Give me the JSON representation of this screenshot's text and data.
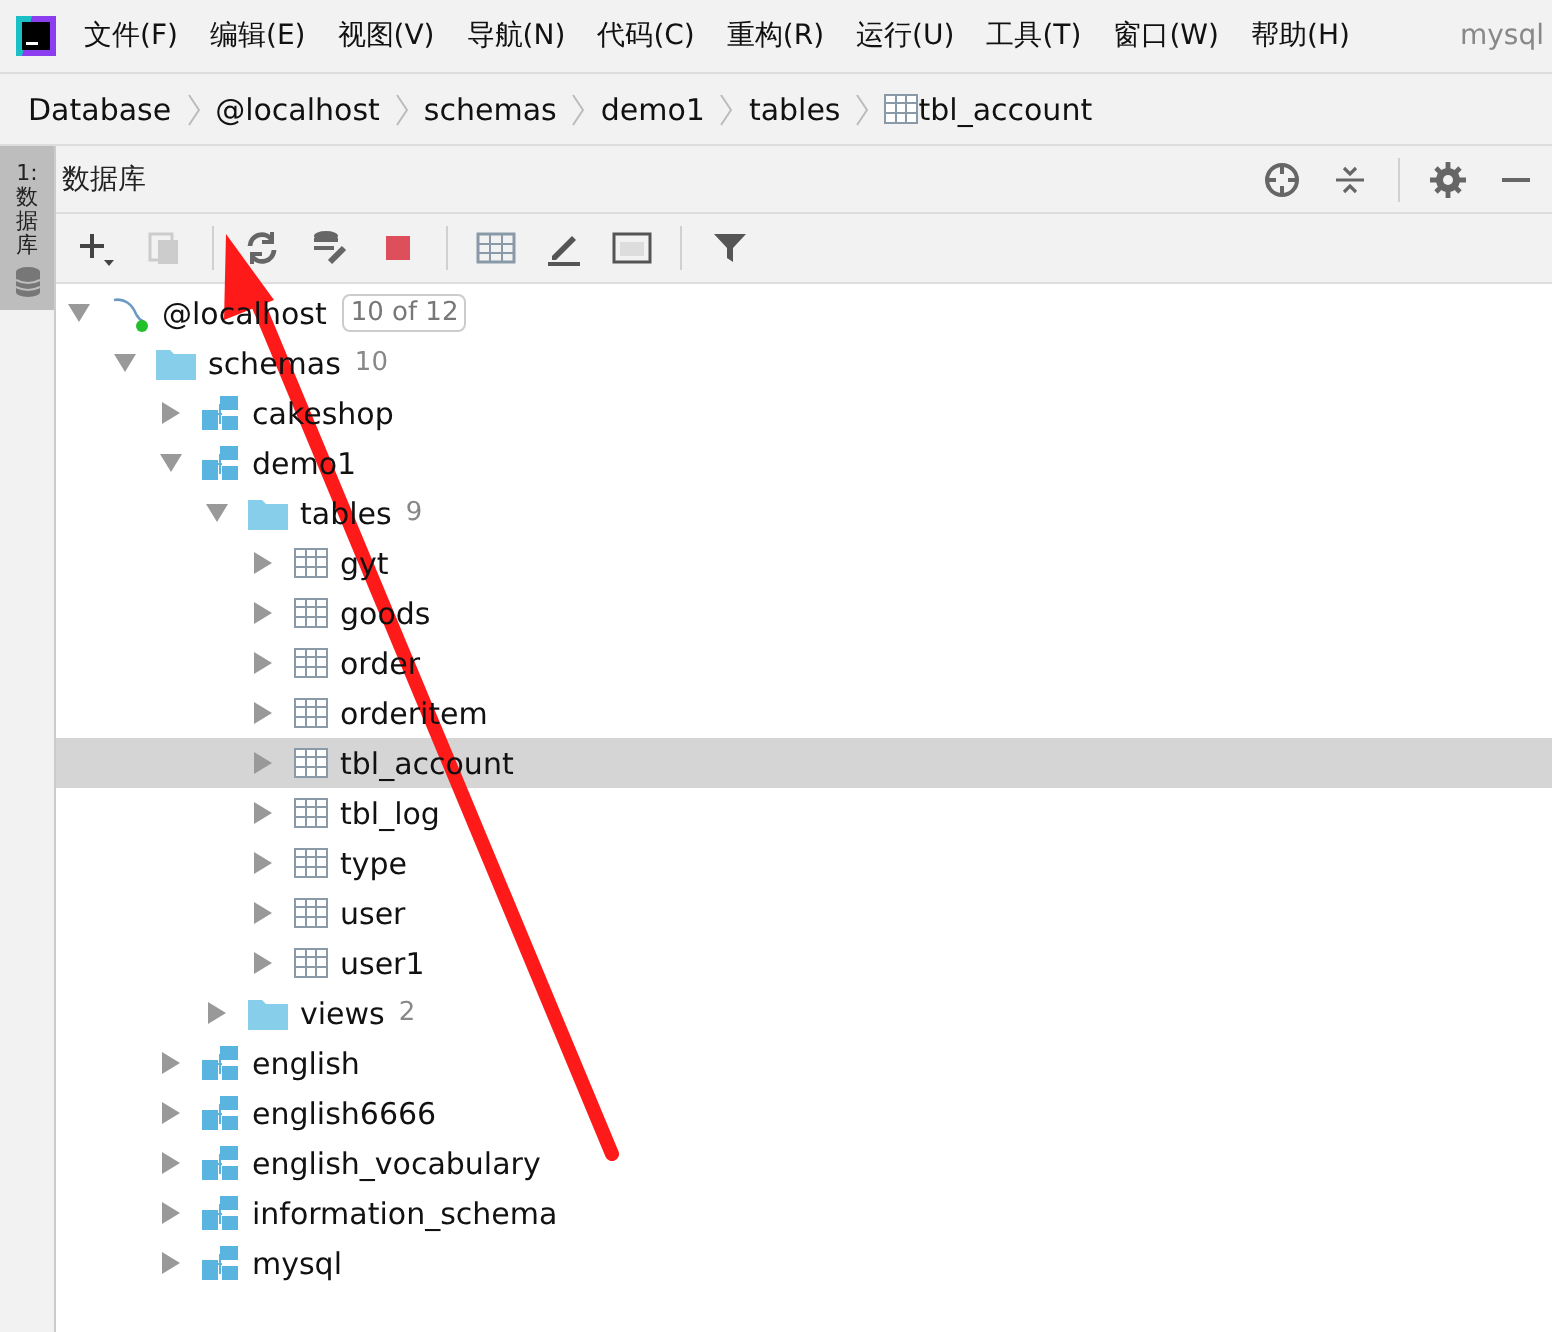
{
  "menu": [
    "文件(F)",
    "编辑(E)",
    "视图(V)",
    "导航(N)",
    "代码(C)",
    "重构(R)",
    "运行(U)",
    "工具(T)",
    "窗口(W)",
    "帮助(H)"
  ],
  "project": "mysql",
  "breadcrumb": [
    {
      "label": "Database",
      "kind": "plain"
    },
    {
      "label": "@localhost",
      "kind": "plain"
    },
    {
      "label": "schemas",
      "kind": "plain"
    },
    {
      "label": "demo1",
      "kind": "plain"
    },
    {
      "label": "tables",
      "kind": "plain"
    },
    {
      "label": "tbl_account",
      "kind": "table"
    }
  ],
  "side_tab": {
    "label": "1: 数据库",
    "selected": true
  },
  "panel": {
    "title": "数据库"
  },
  "tree": [
    {
      "label": "@localhost",
      "kind": "host",
      "badge": "10 of 12",
      "expanded": true,
      "selected": false,
      "children": [
        {
          "label": "schemas",
          "kind": "folder",
          "count": "10",
          "expanded": true,
          "selected": false,
          "children": [
            {
              "label": "cakeshop",
              "kind": "schema",
              "expanded": false,
              "selected": false
            },
            {
              "label": "demo1",
              "kind": "schema",
              "expanded": true,
              "selected": false,
              "children": [
                {
                  "label": "tables",
                  "kind": "folder",
                  "count": "9",
                  "expanded": true,
                  "selected": false,
                  "children": [
                    {
                      "label": "gyt",
                      "kind": "table",
                      "expanded": false,
                      "selected": false
                    },
                    {
                      "label": "goods",
                      "kind": "table",
                      "expanded": false,
                      "selected": false
                    },
                    {
                      "label": "order",
                      "kind": "table",
                      "expanded": false,
                      "selected": false
                    },
                    {
                      "label": "orderitem",
                      "kind": "table",
                      "expanded": false,
                      "selected": false
                    },
                    {
                      "label": "tbl_account",
                      "kind": "table",
                      "expanded": false,
                      "selected": true
                    },
                    {
                      "label": "tbl_log",
                      "kind": "table",
                      "expanded": false,
                      "selected": false
                    },
                    {
                      "label": "type",
                      "kind": "table",
                      "expanded": false,
                      "selected": false
                    },
                    {
                      "label": "user",
                      "kind": "table",
                      "expanded": false,
                      "selected": false
                    },
                    {
                      "label": "user1",
                      "kind": "table",
                      "expanded": false,
                      "selected": false
                    }
                  ]
                },
                {
                  "label": "views",
                  "kind": "folder",
                  "count": "2",
                  "expanded": false,
                  "selected": false
                }
              ]
            },
            {
              "label": "english",
              "kind": "schema",
              "expanded": false,
              "selected": false
            },
            {
              "label": "english6666",
              "kind": "schema",
              "expanded": false,
              "selected": false
            },
            {
              "label": "english_vocabulary",
              "kind": "schema",
              "expanded": false,
              "selected": false
            },
            {
              "label": "information_schema",
              "kind": "schema",
              "expanded": false,
              "selected": false
            },
            {
              "label": "mysql",
              "kind": "schema",
              "expanded": false,
              "selected": false
            }
          ]
        }
      ]
    }
  ]
}
